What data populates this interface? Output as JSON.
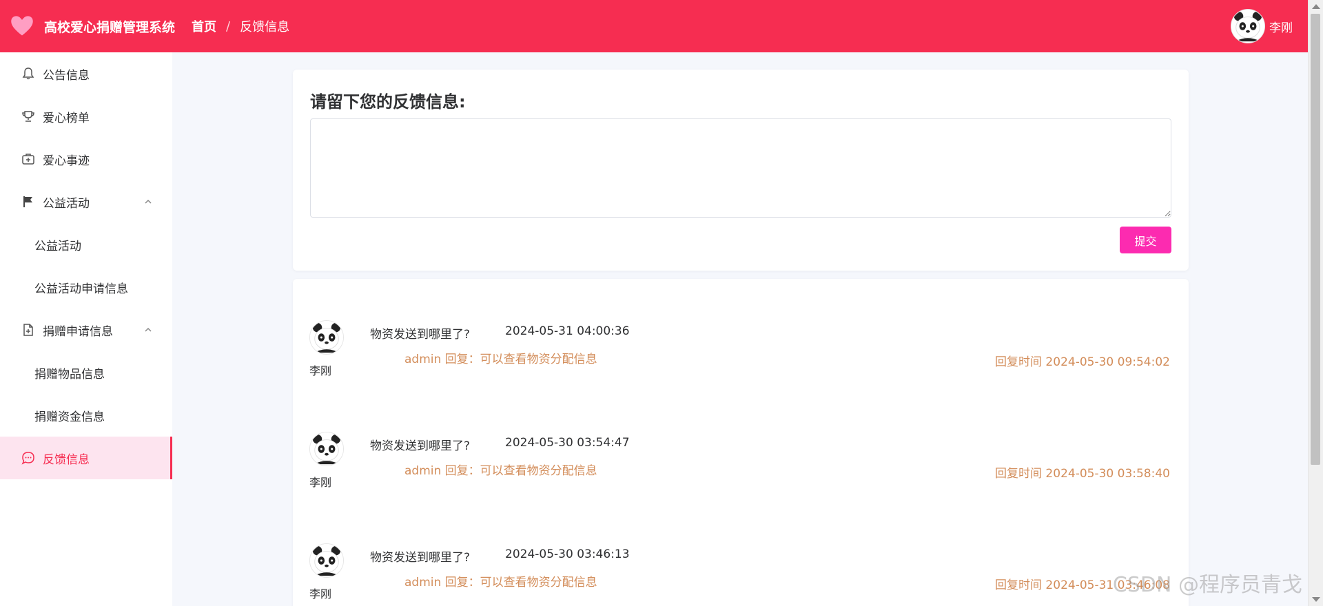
{
  "header": {
    "app_title": "高校爱心捐赠管理系统",
    "breadcrumb_home": "首页",
    "breadcrumb_sep": "/",
    "breadcrumb_current": "反馈信息",
    "user_name": "李刚",
    "bg_color": "#f62d51"
  },
  "sidebar": {
    "items": [
      {
        "label": "公告信息",
        "icon": "bell-icon"
      },
      {
        "label": "爱心榜单",
        "icon": "trophy-icon"
      },
      {
        "label": "爱心事迹",
        "icon": "first-aid-icon"
      },
      {
        "label": "公益活动",
        "icon": "flag-icon",
        "expanded": true
      },
      {
        "label": "公益活动",
        "sub": true
      },
      {
        "label": "公益活动申请信息",
        "sub": true
      },
      {
        "label": "捐赠申请信息",
        "icon": "document-add-icon",
        "expanded": true
      },
      {
        "label": "捐赠物品信息",
        "sub": true
      },
      {
        "label": "捐赠资金信息",
        "sub": true
      },
      {
        "label": "反馈信息",
        "icon": "chat-icon",
        "active": true
      }
    ]
  },
  "feedback_form": {
    "title": "请留下您的反馈信息:",
    "textarea_value": "",
    "submit_label": "提交",
    "submit_color": "#fc2bb0"
  },
  "feedback_list": [
    {
      "user": "李刚",
      "question": "物资发送到哪里了?",
      "time": "2024-05-31 04:00:36",
      "reply": "admin 回复：可以查看物资分配信息",
      "reply_time": "回复时间 2024-05-30 09:54:02"
    },
    {
      "user": "李刚",
      "question": "物资发送到哪里了?",
      "time": "2024-05-30 03:54:47",
      "reply": "admin 回复：可以查看物资分配信息",
      "reply_time": "回复时间 2024-05-30 03:58:40"
    },
    {
      "user": "李刚",
      "question": "物资发送到哪里了?",
      "time": "2024-05-30 03:46:13",
      "reply": "admin 回复：可以查看物资分配信息",
      "reply_time": "回复时间 2024-05-31 03:46:08"
    }
  ],
  "watermark": "CSDN @程序员青戈"
}
